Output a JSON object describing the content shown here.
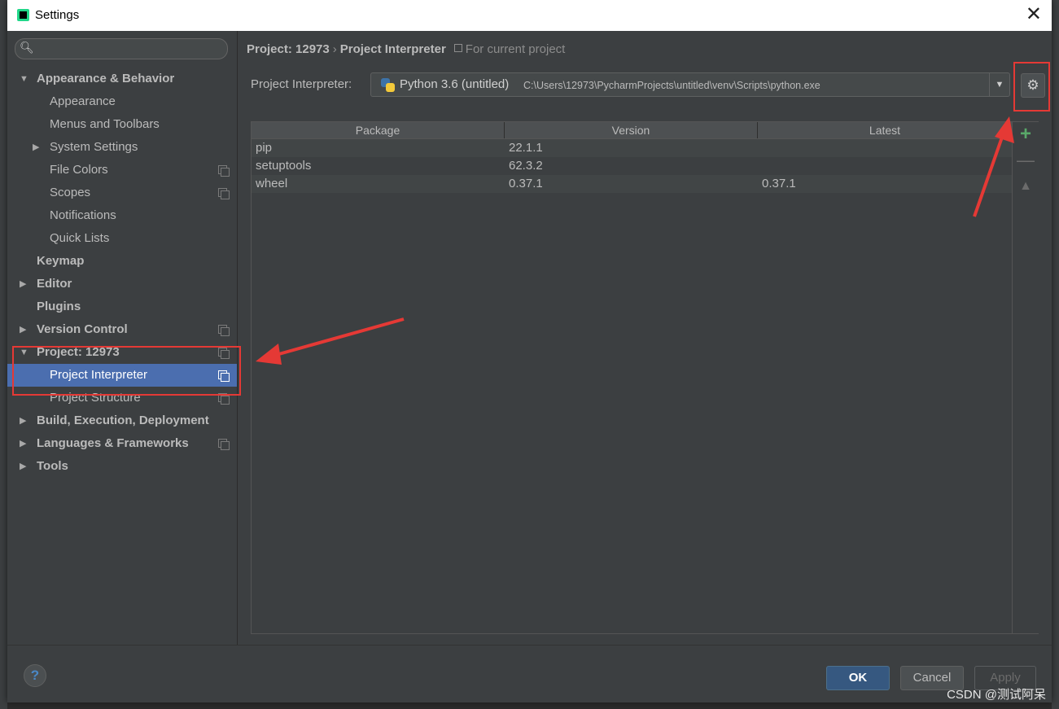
{
  "window": {
    "title": "Settings"
  },
  "search": {
    "placeholder": ""
  },
  "sidebar": {
    "items": [
      {
        "label": "Appearance & Behavior",
        "bold": true,
        "arrow": "expanded"
      },
      {
        "label": "Appearance"
      },
      {
        "label": "Menus and Toolbars"
      },
      {
        "label": "System Settings",
        "arrow": "collapsed"
      },
      {
        "label": "File Colors",
        "project_scoped": true
      },
      {
        "label": "Scopes",
        "project_scoped": true
      },
      {
        "label": "Notifications"
      },
      {
        "label": "Quick Lists"
      },
      {
        "label": "Keymap",
        "bold": true
      },
      {
        "label": "Editor",
        "bold": true,
        "arrow": "collapsed"
      },
      {
        "label": "Plugins",
        "bold": true
      },
      {
        "label": "Version Control",
        "bold": true,
        "arrow": "collapsed",
        "project_scoped": true
      },
      {
        "label": "Project: 12973",
        "bold": true,
        "arrow": "expanded",
        "project_scoped": true
      },
      {
        "label": "Project Interpreter",
        "selected": true,
        "project_scoped": true
      },
      {
        "label": "Project Structure",
        "project_scoped": true
      },
      {
        "label": "Build, Execution, Deployment",
        "bold": true,
        "arrow": "collapsed"
      },
      {
        "label": "Languages & Frameworks",
        "bold": true,
        "arrow": "collapsed",
        "project_scoped": true
      },
      {
        "label": "Tools",
        "bold": true,
        "arrow": "collapsed"
      }
    ]
  },
  "breadcrumb": {
    "project": "Project: 12973",
    "separator": "›",
    "page": "Project Interpreter",
    "hint": "For current project"
  },
  "interpreter": {
    "label": "Project Interpreter:",
    "name": "Python 3.6 (untitled)",
    "path": "C:\\Users\\12973\\PycharmProjects\\untitled\\venv\\Scripts\\python.exe"
  },
  "packages": {
    "columns": [
      "Package",
      "Version",
      "Latest"
    ],
    "rows": [
      [
        "pip",
        "22.1.1",
        ""
      ],
      [
        "setuptools",
        "62.3.2",
        ""
      ],
      [
        "wheel",
        "0.37.1",
        "0.37.1"
      ]
    ]
  },
  "tools": {
    "add": "+",
    "remove": "—",
    "upgrade": "🡅"
  },
  "buttons": {
    "ok": "OK",
    "cancel": "Cancel",
    "apply": "Apply",
    "help": "?"
  },
  "watermark": "CSDN @测试阿呆",
  "colors": {
    "selection": "#4b6eaf",
    "annotation_red": "#e53935",
    "add_green": "#59a869"
  }
}
